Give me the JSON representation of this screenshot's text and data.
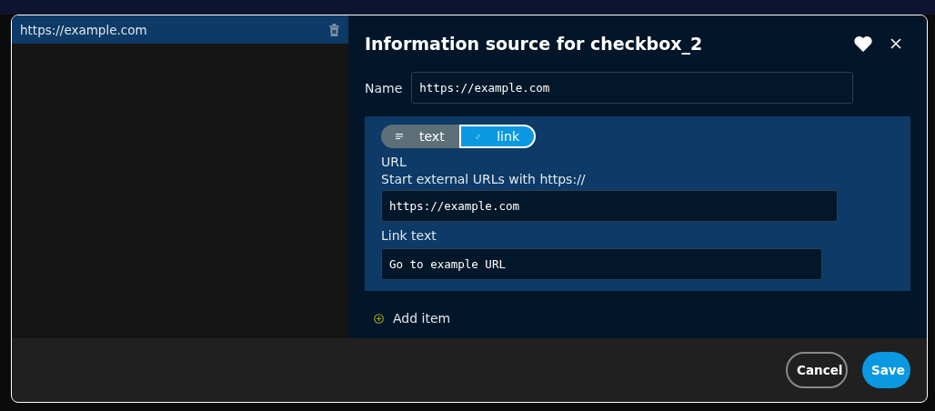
{
  "sources": [
    {
      "label": "https://example.com",
      "selected": true
    }
  ],
  "dialog": {
    "title": "Information source for checkbox_2",
    "favorite": true,
    "name_field": {
      "label": "Name",
      "value": "https://example.com"
    },
    "item": {
      "tabs": [
        {
          "label": "text",
          "kind": "text",
          "selected": false
        },
        {
          "label": "link",
          "kind": "link",
          "selected": true
        }
      ],
      "url_label": "URL",
      "url_hint": "Start external URLs with https://",
      "url_value": "https://example.com",
      "link_text_label": "Link text",
      "link_text_value": "Go to example URL"
    },
    "add_item": "Add item",
    "buttons": [
      {
        "label": "Cancel",
        "kind": "secondary"
      },
      {
        "label": "Save",
        "kind": "primary"
      }
    ]
  }
}
